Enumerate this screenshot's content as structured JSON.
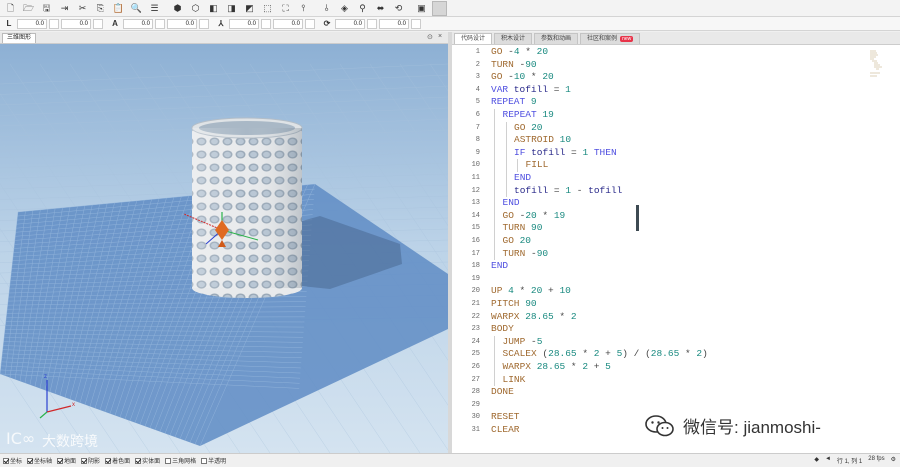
{
  "toolbar": {
    "icons": [
      "new-file-icon",
      "open-folder-icon",
      "save-icon",
      "export-icon",
      "cut-icon",
      "copy-icon",
      "paste-icon",
      "find-icon",
      "list-icon",
      "cube-solid-icon",
      "cube-front-icon",
      "cube-side-icon",
      "cube-top-icon",
      "cube-iso-icon",
      "cube-wire-icon",
      "fit-view-icon",
      "axis-x-icon",
      "axis-y-icon",
      "camera-icon",
      "pin-icon",
      "move-icon",
      "rotate-icon",
      "box-icon",
      "stop-icon"
    ],
    "glyphs": [
      "🗋",
      "🗁",
      "🖫",
      "⇥",
      "✂",
      "⎘",
      "📋",
      "🔍",
      "☰",
      "⬢",
      "⬡",
      "◧",
      "◨",
      "◩",
      "⬚",
      "⛶",
      "⫯",
      "⫰",
      "◈",
      "⚲",
      "⬌",
      "⟲",
      "▣"
    ]
  },
  "fields": {
    "groups": [
      {
        "icon": "L",
        "v1": "0.0",
        "v2": "0.0"
      },
      {
        "icon": "A",
        "v1": "0.0",
        "v2": "0.0"
      },
      {
        "icon": "⅄",
        "v1": "0.0",
        "v2": "0.0"
      },
      {
        "icon": "⟳",
        "v1": "0.0",
        "v2": "0.0"
      }
    ]
  },
  "view_panel": {
    "tab_label": "三维图形",
    "ctl_pin": "⊙",
    "ctl_close": "×"
  },
  "code_panel": {
    "tabs": [
      {
        "label": "代码设计",
        "active": true
      },
      {
        "label": "积木设计",
        "active": false
      },
      {
        "label": "参数和动画",
        "active": false
      },
      {
        "label": "社区和案例",
        "active": false,
        "badge": "new"
      }
    ]
  },
  "code": [
    {
      "n": "1",
      "indent": 0,
      "parts": [
        [
          "cmd",
          "GO"
        ],
        [
          "op",
          " -"
        ],
        [
          "num",
          "4"
        ],
        [
          "op",
          " * "
        ],
        [
          "num",
          "20"
        ]
      ]
    },
    {
      "n": "2",
      "indent": 0,
      "parts": [
        [
          "cmd",
          "TURN"
        ],
        [
          "op",
          " -"
        ],
        [
          "num",
          "90"
        ]
      ]
    },
    {
      "n": "3",
      "indent": 0,
      "parts": [
        [
          "cmd",
          "GO"
        ],
        [
          "op",
          " -"
        ],
        [
          "num",
          "10"
        ],
        [
          "op",
          " * "
        ],
        [
          "num",
          "20"
        ]
      ]
    },
    {
      "n": "4",
      "indent": 0,
      "parts": [
        [
          "kw2",
          "VAR"
        ],
        [
          "cmd2",
          " tofill"
        ],
        [
          "op",
          " = "
        ],
        [
          "num",
          "1"
        ]
      ]
    },
    {
      "n": "5",
      "indent": 0,
      "parts": [
        [
          "kw2",
          "REPEAT"
        ],
        [
          "op",
          " "
        ],
        [
          "num",
          "9"
        ]
      ]
    },
    {
      "n": "6",
      "indent": 1,
      "parts": [
        [
          "kw2",
          "REPEAT"
        ],
        [
          "op",
          " "
        ],
        [
          "num",
          "19"
        ]
      ]
    },
    {
      "n": "7",
      "indent": 2,
      "parts": [
        [
          "cmd",
          "GO"
        ],
        [
          "op",
          " "
        ],
        [
          "num",
          "20"
        ]
      ]
    },
    {
      "n": "8",
      "indent": 2,
      "parts": [
        [
          "cmd",
          "ASTROID"
        ],
        [
          "op",
          " "
        ],
        [
          "num",
          "10"
        ]
      ]
    },
    {
      "n": "9",
      "indent": 2,
      "parts": [
        [
          "kw2",
          "IF"
        ],
        [
          "cmd2",
          " tofill"
        ],
        [
          "op",
          " = "
        ],
        [
          "num",
          "1"
        ],
        [
          "kw2",
          " THEN"
        ]
      ]
    },
    {
      "n": "10",
      "indent": 3,
      "parts": [
        [
          "cmd",
          "FILL"
        ]
      ]
    },
    {
      "n": "11",
      "indent": 2,
      "parts": [
        [
          "kw2",
          "END"
        ]
      ]
    },
    {
      "n": "12",
      "indent": 2,
      "parts": [
        [
          "cmd2",
          "tofill"
        ],
        [
          "op",
          " = "
        ],
        [
          "num",
          "1"
        ],
        [
          "op",
          " - "
        ],
        [
          "cmd2",
          "tofill"
        ]
      ]
    },
    {
      "n": "13",
      "indent": 1,
      "parts": [
        [
          "kw2",
          "END"
        ]
      ]
    },
    {
      "n": "14",
      "indent": 1,
      "parts": [
        [
          "cmd",
          "GO"
        ],
        [
          "op",
          " -"
        ],
        [
          "num",
          "20"
        ],
        [
          "op",
          " * "
        ],
        [
          "num",
          "19"
        ]
      ]
    },
    {
      "n": "15",
      "indent": 1,
      "parts": [
        [
          "cmd",
          "TURN"
        ],
        [
          "op",
          " "
        ],
        [
          "num",
          "90"
        ]
      ]
    },
    {
      "n": "16",
      "indent": 1,
      "parts": [
        [
          "cmd",
          "GO"
        ],
        [
          "op",
          " "
        ],
        [
          "num",
          "20"
        ]
      ]
    },
    {
      "n": "17",
      "indent": 1,
      "parts": [
        [
          "cmd",
          "TURN"
        ],
        [
          "op",
          " -"
        ],
        [
          "num",
          "90"
        ]
      ]
    },
    {
      "n": "18",
      "indent": 0,
      "parts": [
        [
          "kw2",
          "END"
        ]
      ]
    },
    {
      "n": "19",
      "indent": 0,
      "parts": []
    },
    {
      "n": "20",
      "indent": 0,
      "parts": [
        [
          "cmd",
          "UP"
        ],
        [
          "op",
          " "
        ],
        [
          "num",
          "4"
        ],
        [
          "op",
          " * "
        ],
        [
          "num",
          "20"
        ],
        [
          "op",
          " + "
        ],
        [
          "num",
          "10"
        ]
      ]
    },
    {
      "n": "21",
      "indent": 0,
      "parts": [
        [
          "cmd",
          "PITCH"
        ],
        [
          "op",
          " "
        ],
        [
          "num",
          "90"
        ]
      ]
    },
    {
      "n": "22",
      "indent": 0,
      "parts": [
        [
          "cmd",
          "WARPX"
        ],
        [
          "op",
          " "
        ],
        [
          "num",
          "28.65"
        ],
        [
          "op",
          " * "
        ],
        [
          "num",
          "2"
        ]
      ]
    },
    {
      "n": "23",
      "indent": 0,
      "parts": [
        [
          "cmd",
          "BODY"
        ]
      ]
    },
    {
      "n": "24",
      "indent": 1,
      "parts": [
        [
          "cmd",
          "JUMP"
        ],
        [
          "op",
          " -"
        ],
        [
          "num",
          "5"
        ]
      ]
    },
    {
      "n": "25",
      "indent": 1,
      "parts": [
        [
          "cmd",
          "SCALEX"
        ],
        [
          "op",
          " ("
        ],
        [
          "num",
          "28.65"
        ],
        [
          "op",
          " * "
        ],
        [
          "num",
          "2"
        ],
        [
          "op",
          " + "
        ],
        [
          "num",
          "5"
        ],
        [
          "op",
          ") / ("
        ],
        [
          "num",
          "28.65"
        ],
        [
          "op",
          " * "
        ],
        [
          "num",
          "2"
        ],
        [
          "op",
          ")"
        ]
      ]
    },
    {
      "n": "26",
      "indent": 1,
      "parts": [
        [
          "cmd",
          "WARPX"
        ],
        [
          "op",
          " "
        ],
        [
          "num",
          "28.65"
        ],
        [
          "op",
          " * "
        ],
        [
          "num",
          "2"
        ],
        [
          "op",
          " + "
        ],
        [
          "num",
          "5"
        ]
      ]
    },
    {
      "n": "27",
      "indent": 1,
      "parts": [
        [
          "cmd",
          "LINK"
        ]
      ]
    },
    {
      "n": "28",
      "indent": 0,
      "parts": [
        [
          "cmd",
          "DONE"
        ]
      ]
    },
    {
      "n": "29",
      "indent": 0,
      "parts": []
    },
    {
      "n": "30",
      "indent": 0,
      "parts": [
        [
          "cmd",
          "RESET"
        ]
      ]
    },
    {
      "n": "31",
      "indent": 0,
      "parts": [
        [
          "cmd",
          "CLEAR"
        ]
      ]
    }
  ],
  "status": {
    "checkboxes": [
      {
        "label": "坐标",
        "checked": true
      },
      {
        "label": "坐标轴",
        "checked": true
      },
      {
        "label": "地面",
        "checked": true
      },
      {
        "label": "阴影",
        "checked": true
      },
      {
        "label": "着色面",
        "checked": true
      },
      {
        "label": "实体面",
        "checked": true
      },
      {
        "label": "三角网格",
        "checked": false
      },
      {
        "label": "半透明",
        "checked": false
      }
    ],
    "right": [
      "◆",
      "◄",
      "行 1, 列 1",
      "28 fps",
      "⚙"
    ]
  },
  "watermark": {
    "text": "微信号: jianmoshi-",
    "logo_text": "大数跨境"
  },
  "colors": {
    "grid_floor": "#5f8cc4",
    "sky_top": "#8db0d4",
    "sky_bottom": "#c9dcec",
    "object": "#e4e6e8"
  }
}
